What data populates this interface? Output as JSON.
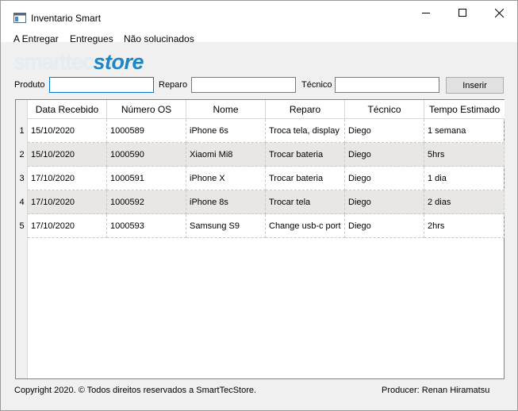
{
  "window": {
    "title": "Inventario Smart"
  },
  "menu": [
    "A Entregar",
    "Entregues",
    "Não solucinados"
  ],
  "logo": {
    "part1": "smarttec",
    "part2": "store"
  },
  "form": {
    "produto_label": "Produto",
    "reparo_label": "Reparo",
    "tecnico_label": "Técnico",
    "produto_value": "",
    "reparo_value": "",
    "tecnico_value": "",
    "insert_label": "Inserir"
  },
  "table": {
    "columns": [
      "Data Recebido",
      "Número OS",
      "Nome",
      "Reparo",
      "Técnico",
      "Tempo Estimado"
    ],
    "row_numbers": [
      "1",
      "2",
      "3",
      "4",
      "5"
    ],
    "rows": [
      [
        "15/10/2020",
        "1000589",
        "iPhone 6s",
        "Troca tela, display",
        "Diego",
        "1 semana"
      ],
      [
        "15/10/2020",
        "1000590",
        "Xiaomi Mi8",
        "Trocar bateria",
        "Diego",
        "5hrs"
      ],
      [
        "17/10/2020",
        "1000591",
        "iPhone X",
        "Trocar bateria",
        "Diego",
        "1 dia"
      ],
      [
        "17/10/2020",
        "1000592",
        "iPhone  8s",
        "Trocar tela",
        "Diego",
        "2 dias"
      ],
      [
        "17/10/2020",
        "1000593",
        "Samsung S9",
        "Change usb-c port",
        "Diego",
        "2hrs"
      ]
    ]
  },
  "footer": {
    "copyright": "Copyright 2020. © Todos direitos reservados a SmartTecStore.",
    "producer": "Producer: Renan Hiramatsu"
  },
  "colors": {
    "accent": "#0078d7",
    "logo_blue": "#1d86c8",
    "alt_row": "#e9e7e3"
  }
}
